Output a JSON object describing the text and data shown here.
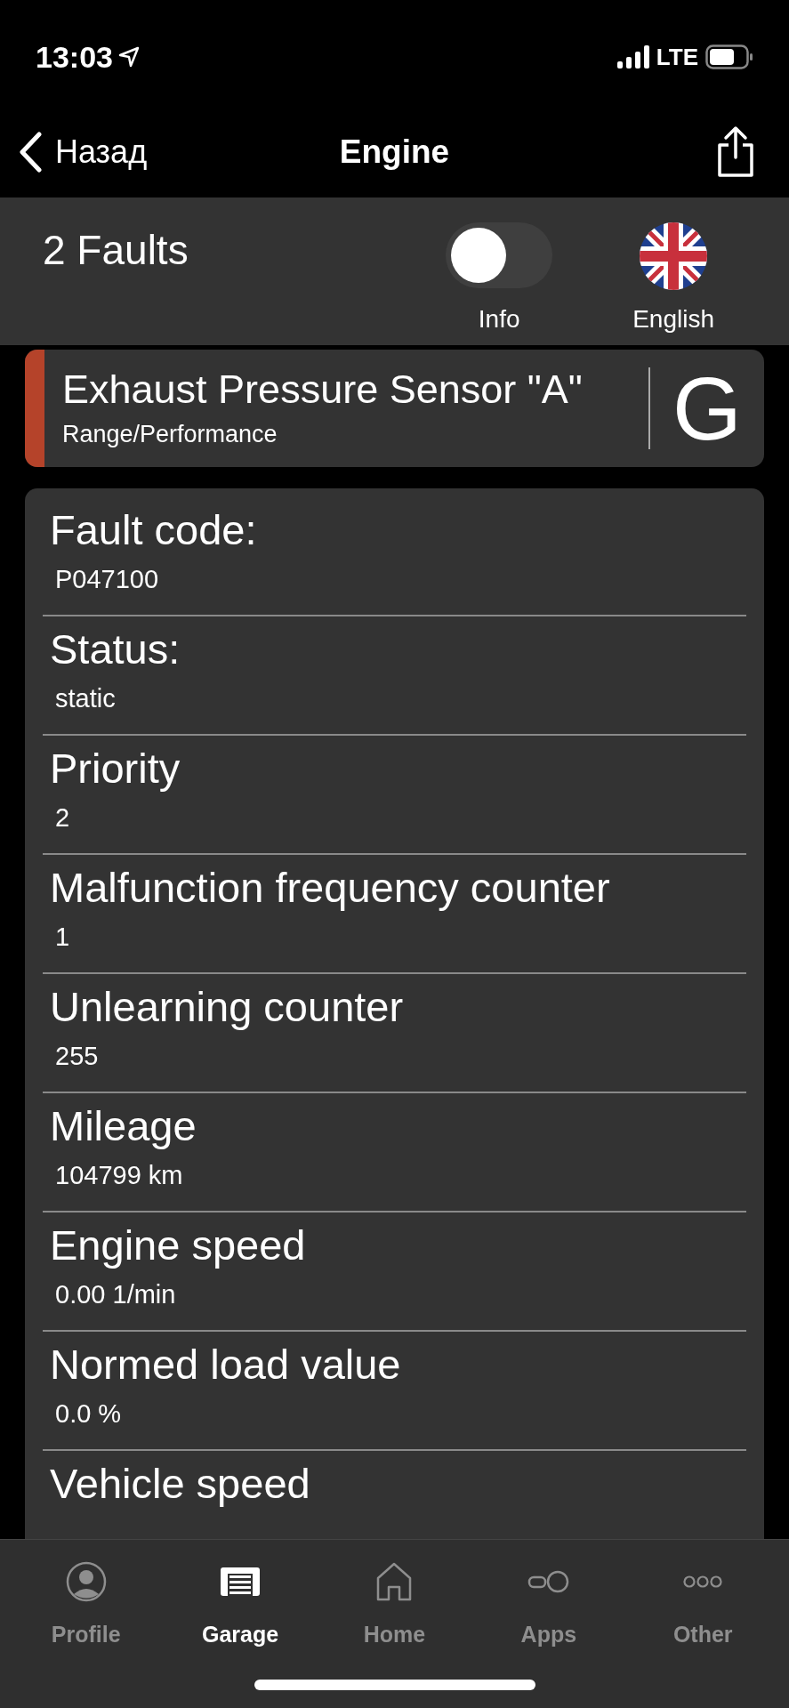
{
  "status_bar": {
    "time": "13:03",
    "network": "LTE"
  },
  "nav": {
    "back": "Назад",
    "title": "Engine"
  },
  "summary": {
    "faults": "2 Faults",
    "info_toggle": {
      "label": "Info",
      "on": false
    },
    "language": "English"
  },
  "fault": {
    "title": "Exhaust Pressure Sensor \"A\"",
    "subtitle": "Range/Performance",
    "color": "#b5432a",
    "translate": "G"
  },
  "details": [
    {
      "label": "Fault code:",
      "value": "P047100"
    },
    {
      "label": "Status:",
      "value": "static"
    },
    {
      "label": "Priority",
      "value": "2"
    },
    {
      "label": "Malfunction frequency counter",
      "value": "1"
    },
    {
      "label": "Unlearning counter",
      "value": "255"
    },
    {
      "label": "Mileage",
      "value": "104799 km"
    },
    {
      "label": "Engine speed",
      "value": "0.00 1/min"
    },
    {
      "label": "Normed load value",
      "value": "0.0 %"
    },
    {
      "label": "Vehicle speed"
    }
  ],
  "tabs": [
    {
      "label": "Profile",
      "kind": "profile",
      "selected": false
    },
    {
      "label": "Garage",
      "kind": "garage",
      "selected": true
    },
    {
      "label": "Home",
      "kind": "home",
      "selected": false
    },
    {
      "label": "Apps",
      "kind": "apps",
      "selected": false
    },
    {
      "label": "Other",
      "kind": "other",
      "selected": false
    }
  ]
}
